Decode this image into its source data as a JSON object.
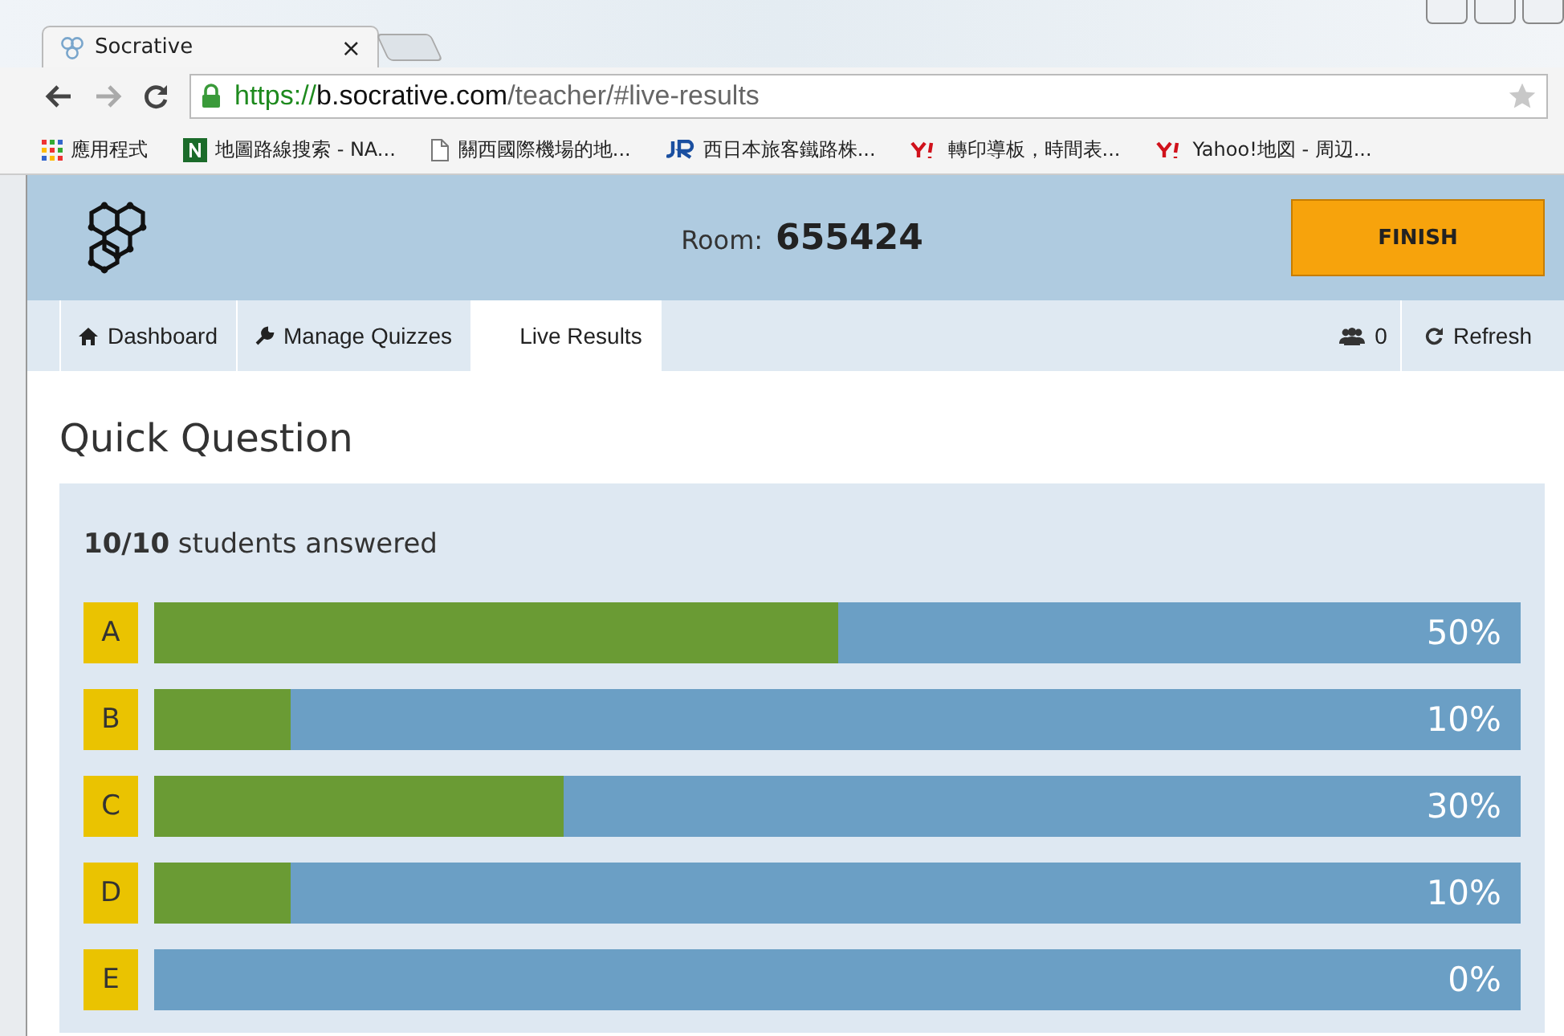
{
  "browser": {
    "tab": {
      "title": "Socrative",
      "close": "×"
    },
    "url": {
      "scheme": "https://",
      "host": "b.socrative.com",
      "path": "/teacher/#live-results"
    },
    "bookmarks": [
      {
        "kind": "apps",
        "label": "應用程式"
      },
      {
        "kind": "n",
        "label": "地圖路線搜索 - NA..."
      },
      {
        "kind": "page",
        "label": "關西國際機場的地..."
      },
      {
        "kind": "jr",
        "label": "西日本旅客鐵路株..."
      },
      {
        "kind": "yahoo",
        "label": "轉印導板，時間表..."
      },
      {
        "kind": "yahoo",
        "label": "Yahoo!地図 - 周辺..."
      }
    ]
  },
  "header": {
    "room_label": "Room:",
    "room_number": "655424",
    "finish_button": "FINISH"
  },
  "nav": {
    "tabs": [
      {
        "kind": "home",
        "label": "Dashboard",
        "selected": false
      },
      {
        "kind": "wrench",
        "label": "Manage Quizzes",
        "selected": false
      },
      {
        "kind": "plain",
        "label": "Live Results",
        "selected": true
      }
    ],
    "students_count": "0",
    "refresh": "Refresh"
  },
  "title": "Quick Question",
  "summary": "**10/10** students answered",
  "answers": [
    {
      "letter": "A",
      "level": 0.5,
      "percent": "50%"
    },
    {
      "letter": "B",
      "level": 0.1,
      "percent": "10%"
    },
    {
      "letter": "C",
      "level": 0.3,
      "percent": "30%"
    },
    {
      "letter": "D",
      "level": 0.1,
      "percent": "10%"
    },
    {
      "letter": "E",
      "level": 0,
      "percent": "0%"
    }
  ]
}
